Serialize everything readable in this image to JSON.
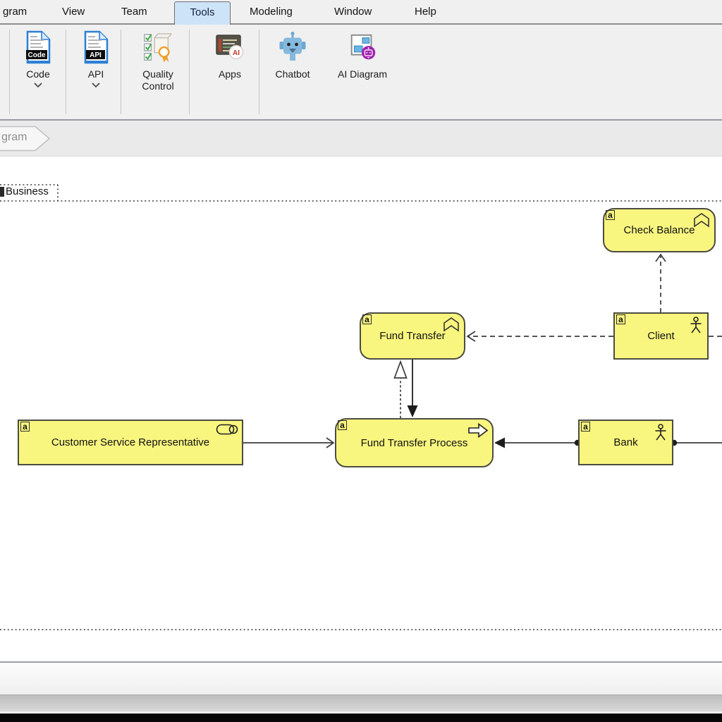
{
  "menu": {
    "items": [
      "gram",
      "View",
      "Team",
      "Tools",
      "Modeling",
      "Window",
      "Help"
    ],
    "active_item": "Tools"
  },
  "toolbar": {
    "buttons": [
      {
        "label": "Code",
        "icon": "code-document-icon",
        "icon_text": "Code",
        "has_dropdown": true
      },
      {
        "label": "API",
        "icon": "api-document-icon",
        "icon_text": "API",
        "has_dropdown": true
      },
      {
        "label": "Quality Control",
        "icon": "quality-control-icon",
        "has_dropdown": false
      },
      {
        "label": "Apps",
        "icon": "apps-terminal-icon",
        "icon_text": "AI",
        "has_dropdown": false
      },
      {
        "label": "Chatbot",
        "icon": "chatbot-robot-icon",
        "has_dropdown": false
      },
      {
        "label": "AI Diagram",
        "icon": "ai-diagram-icon",
        "has_dropdown": false
      }
    ]
  },
  "breadcrumb": {
    "label": "gram"
  },
  "diagram": {
    "element_marker": "a",
    "group": {
      "label": "Business",
      "marker": "a",
      "border_style": "dotted"
    },
    "nodes": [
      {
        "label": "Check Balance",
        "shape": "rounded-rectangle",
        "icon": "chevron-banner"
      },
      {
        "label": "Fund Transfer",
        "shape": "rounded-rectangle",
        "icon": "chevron-banner"
      },
      {
        "label": "Client",
        "shape": "rectangle",
        "icon": "business-actor"
      },
      {
        "label": "Customer Service Representative",
        "shape": "rectangle",
        "icon": "business-role"
      },
      {
        "label": "Fund Transfer Process",
        "shape": "rounded-rectangle",
        "icon": "process-arrow"
      },
      {
        "label": "Bank",
        "shape": "rectangle",
        "icon": "business-actor"
      }
    ],
    "relationships": [
      {
        "from": "Customer Service Representative",
        "to": "Fund Transfer Process",
        "line": "solid",
        "arrow": "open"
      },
      {
        "from": "Bank",
        "to": "Fund Transfer Process",
        "line": "solid",
        "arrow": "filled-triangle",
        "source_marker": "ball"
      },
      {
        "from": "Bank",
        "to": "off-canvas-right",
        "line": "solid",
        "source_marker": "ball"
      },
      {
        "from": "Client",
        "to": "Fund Transfer",
        "line": "dashed",
        "arrow": "open"
      },
      {
        "from": "Client",
        "to": "off-canvas-right",
        "line": "dashed"
      },
      {
        "from": "Client",
        "to": "Check Balance",
        "line": "dashed",
        "arrow": "open"
      },
      {
        "from": "Fund Transfer Process",
        "to": "Fund Transfer",
        "line": "dashed",
        "arrow": "hollow-triangle"
      },
      {
        "from": "Fund Transfer",
        "to": "Fund Transfer Process",
        "line": "solid",
        "arrow": "filled-triangle"
      }
    ],
    "colors": {
      "node_fill": "#f9f67f",
      "node_border": "#4c4c41",
      "connector": "#3b3b3b",
      "canvas": "#ffffff"
    }
  },
  "chrome_colors": {
    "active_tab_fill": "#cde4f8",
    "bar_background": "#f0f0f0",
    "breadcrumb_background": "#eaeaea"
  }
}
